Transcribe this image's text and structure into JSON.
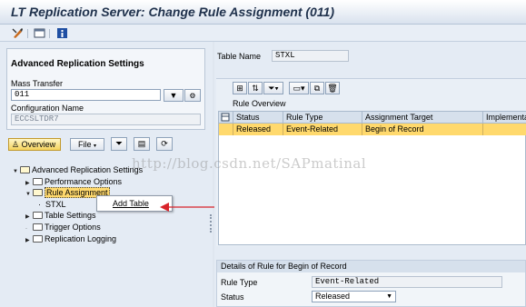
{
  "window": {
    "title": "LT Replication Server: Change Rule Assignment (011)"
  },
  "toolbar": {
    "icons": [
      "display-change-icon",
      "layout-icon",
      "info-icon"
    ]
  },
  "settings": {
    "title": "Advanced Replication Settings",
    "mass_transfer_label": "Mass Transfer",
    "mass_transfer_value": "011",
    "config_label": "Configuration Name",
    "config_value": "ECCSLTDR7"
  },
  "left_buttons": {
    "overview": "Overview",
    "file": "File"
  },
  "tree": {
    "root": "Advanced Replication Settings",
    "items": [
      {
        "label": "Performance Options"
      },
      {
        "label": "Rule Assignment"
      },
      {
        "label": "STXL"
      },
      {
        "label": "Table Settings"
      },
      {
        "label": "Trigger Options"
      },
      {
        "label": "Replication Logging"
      }
    ]
  },
  "context_menu": {
    "add_table": "Add Table"
  },
  "watermark": "http://blog.csdn.net/SAPmatinal",
  "right": {
    "table_name_label": "Table Name",
    "table_name_value": "STXL",
    "rule_overview_label": "Rule Overview",
    "columns": [
      "Status",
      "Rule Type",
      "Assignment Target",
      "Implementa"
    ],
    "rows": [
      {
        "status": "Released",
        "rule_type": "Event-Related",
        "target": "Begin of Record",
        "impl": ""
      }
    ],
    "details": {
      "title": "Details of Rule for Begin of Record",
      "rule_type_label": "Rule Type",
      "rule_type_value": "Event-Related",
      "status_label": "Status",
      "status_value": "Released"
    }
  },
  "colors": {
    "selected_row": "#ffd96d",
    "arrow": "#d8232a",
    "title_text": "#20324d"
  }
}
